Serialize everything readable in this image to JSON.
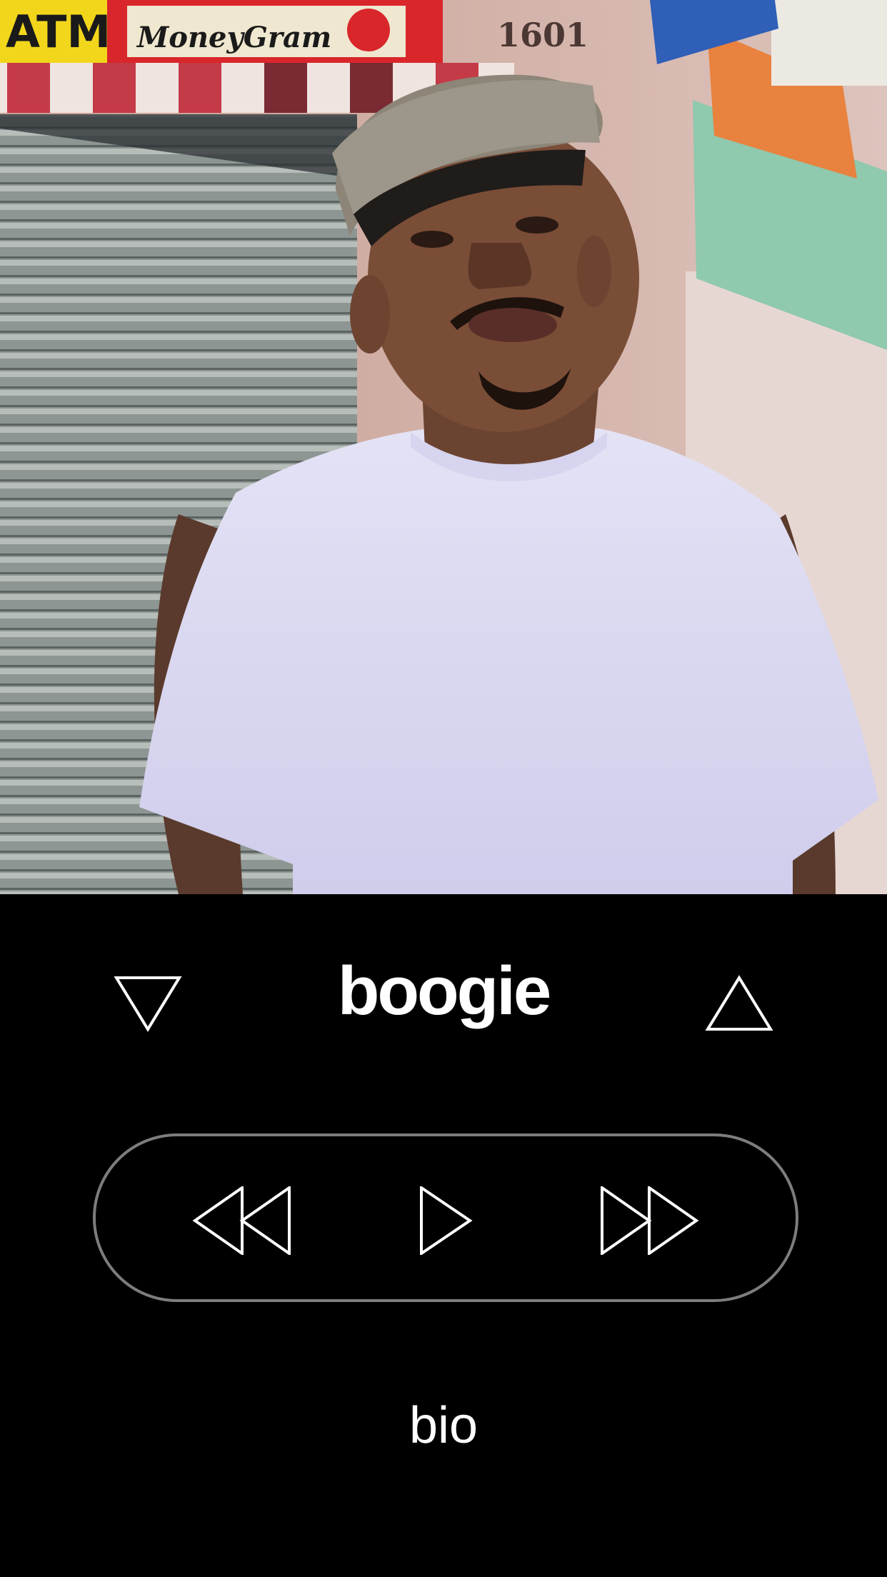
{
  "artist": {
    "name": "boogie",
    "photo_icon": "artist-photo"
  },
  "photo_signs": {
    "atm": "ATM",
    "moneygram": "MoneyGram",
    "address": "1601"
  },
  "nav": {
    "prev_icon": "triangle-down-icon",
    "next_icon": "triangle-up-icon"
  },
  "transport": {
    "rewind_icon": "rewind-icon",
    "play_icon": "play-icon",
    "forward_icon": "fast-forward-icon"
  },
  "bio": {
    "label": "bio"
  },
  "colors": {
    "background": "#000000",
    "text": "#ffffff",
    "pill_border": "#7d7d7d"
  }
}
